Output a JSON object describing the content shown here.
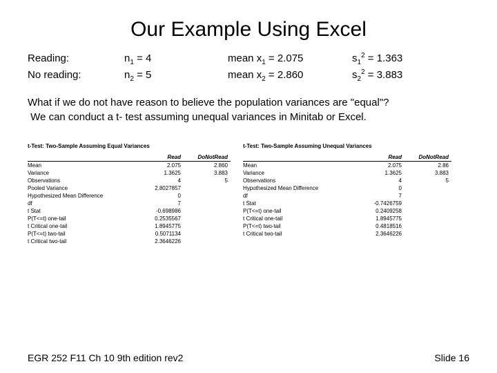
{
  "title": "Our Example Using Excel",
  "info": {
    "r1c1": "Reading:",
    "r1c2_pre": "n",
    "r1c2_sub": "1",
    "r1c2_post": " = 4",
    "r1c3_pre": "mean x",
    "r1c3_sub": "1",
    "r1c3_post": " = 2.075",
    "r1c4_pre": "s",
    "r1c4_sub": "1",
    "r1c4_sup": "2",
    "r1c4_post": " = 1.363",
    "r2c1": "No reading:",
    "r2c2_pre": "n",
    "r2c2_sub": "2",
    "r2c2_post": " = 5",
    "r2c3_pre": "mean x",
    "r2c3_sub": "2",
    "r2c3_post": " = 2.860",
    "r2c4_pre": "s",
    "r2c4_sub": "2",
    "r2c4_sup": "2",
    "r2c4_post": " = 3.883"
  },
  "body_line1": "What if we do not have reason to believe the population variances are \"equal\"?",
  "body_line2": "We can conduct a t- test assuming unequal variances in Minitab or Excel.",
  "left": {
    "title": "t-Test: Two-Sample Assuming Equal Variances",
    "col1": "Read",
    "col2": "DoNotRead",
    "rows": [
      {
        "label": "Mean",
        "v1": "2.075",
        "v2": "2.860"
      },
      {
        "label": "Variance",
        "v1": "1.3625",
        "v2": "3.883"
      },
      {
        "label": "Observations",
        "v1": "4",
        "v2": "5"
      },
      {
        "label": "Pooled Variance",
        "v1": "2.8027857",
        "v2": ""
      },
      {
        "label": "Hypothesized Mean Difference",
        "v1": "0",
        "v2": ""
      },
      {
        "label": "df",
        "v1": "7",
        "v2": ""
      },
      {
        "label": "t Stat",
        "v1": "-0.698986",
        "v2": ""
      },
      {
        "label": "P(T<=t) one-tail",
        "v1": "0.2535567",
        "v2": ""
      },
      {
        "label": "t Critical one-tail",
        "v1": "1.8945775",
        "v2": ""
      },
      {
        "label": "P(T<=t) two-tail",
        "v1": "0.5071134",
        "v2": ""
      },
      {
        "label": "t Critical two-tail",
        "v1": "2.3646226",
        "v2": ""
      }
    ]
  },
  "right": {
    "title": "t-Test: Two-Sample Assuming Unequal Variances",
    "col1": "Read",
    "col2": "DoNotRead",
    "rows": [
      {
        "label": "Mean",
        "v1": "2.075",
        "v2": "2.86"
      },
      {
        "label": "Variance",
        "v1": "1.3625",
        "v2": "3.883"
      },
      {
        "label": "Observations",
        "v1": "4",
        "v2": "5"
      },
      {
        "label": "Hypothesized Mean Difference",
        "v1": "0",
        "v2": ""
      },
      {
        "label": "df",
        "v1": "7",
        "v2": ""
      },
      {
        "label": "t Stat",
        "v1": "-0.7426759",
        "v2": ""
      },
      {
        "label": "P(T<=t) one-tail",
        "v1": "0.2409258",
        "v2": ""
      },
      {
        "label": "t Critical one-tail",
        "v1": "1.8945775",
        "v2": ""
      },
      {
        "label": "P(T<=t) two-tail",
        "v1": "0.4818516",
        "v2": ""
      },
      {
        "label": "t Critical two-tail",
        "v1": "2.3646226",
        "v2": ""
      }
    ]
  },
  "footer_left": "EGR 252 F11 Ch 10   9th edition rev2",
  "footer_right": "Slide 16"
}
